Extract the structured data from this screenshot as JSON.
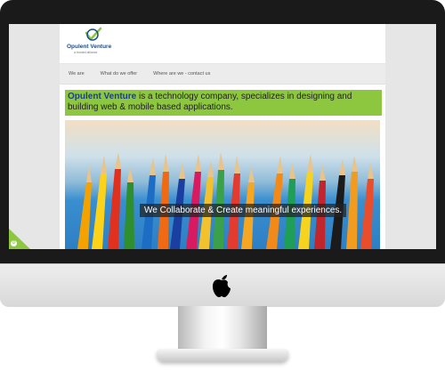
{
  "site": {
    "logo_name": "Opulent Venture",
    "logo_tagline": "a trusted alliance"
  },
  "nav": {
    "items": [
      {
        "label": "We are"
      },
      {
        "label": "What do we offer"
      },
      {
        "label": "Where are we - contact us"
      }
    ]
  },
  "intro": {
    "brand": "Opulent Venture",
    "text": " is a technology company, specializes in designing and building web & mobile based applications."
  },
  "hero": {
    "caption": "We Collaborate & Create meaningful experiences."
  },
  "colors": {
    "accent": "#8dc63f",
    "brand_blue": "#1a4d8c"
  }
}
